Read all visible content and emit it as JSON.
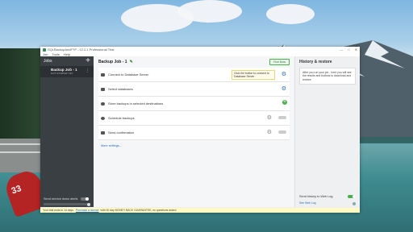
{
  "window": {
    "title": "SQLBackupAndFTP - 12.2.1 Professional Trial",
    "menu": [
      "Job",
      "Tools",
      "Help"
    ],
    "controls": [
      "—",
      "□",
      "✕"
    ]
  },
  "sidebar": {
    "header": "Jobs",
    "add_icon": "+",
    "job": {
      "title": "Backup Job - 1",
      "status": "NOT STARTED YET",
      "menu_icon": "⋮"
    },
    "footer": {
      "alert_label": "Send service down alerts"
    }
  },
  "main": {
    "job_title": "Backup Job - 1",
    "run_button": "Run Now",
    "steps": [
      {
        "label": "Connect to Database Server",
        "icon": "server-icon"
      },
      {
        "label": "Select databases",
        "icon": "database-icon"
      },
      {
        "label": "Store backups in selected destinations",
        "icon": "cloud-icon"
      },
      {
        "label": "Schedule backups",
        "icon": "clock-icon"
      },
      {
        "label": "Send confirmation",
        "icon": "mail-icon"
      }
    ],
    "tooltip": "Click the button to connect to Database Server",
    "more_settings": "More settings..."
  },
  "history": {
    "title": "History & restore",
    "info": "After you run your job - here you will see the results and buttons to download and restore.",
    "send_history": "Send history to Web Log",
    "web_log_link": "See Web Log"
  },
  "trial": {
    "text_before": "Your trial ends in 14 days.",
    "link": "Purchase a license",
    "text_after": "with 30 day MONEY BACK GUARANTEE, no questions asked."
  }
}
